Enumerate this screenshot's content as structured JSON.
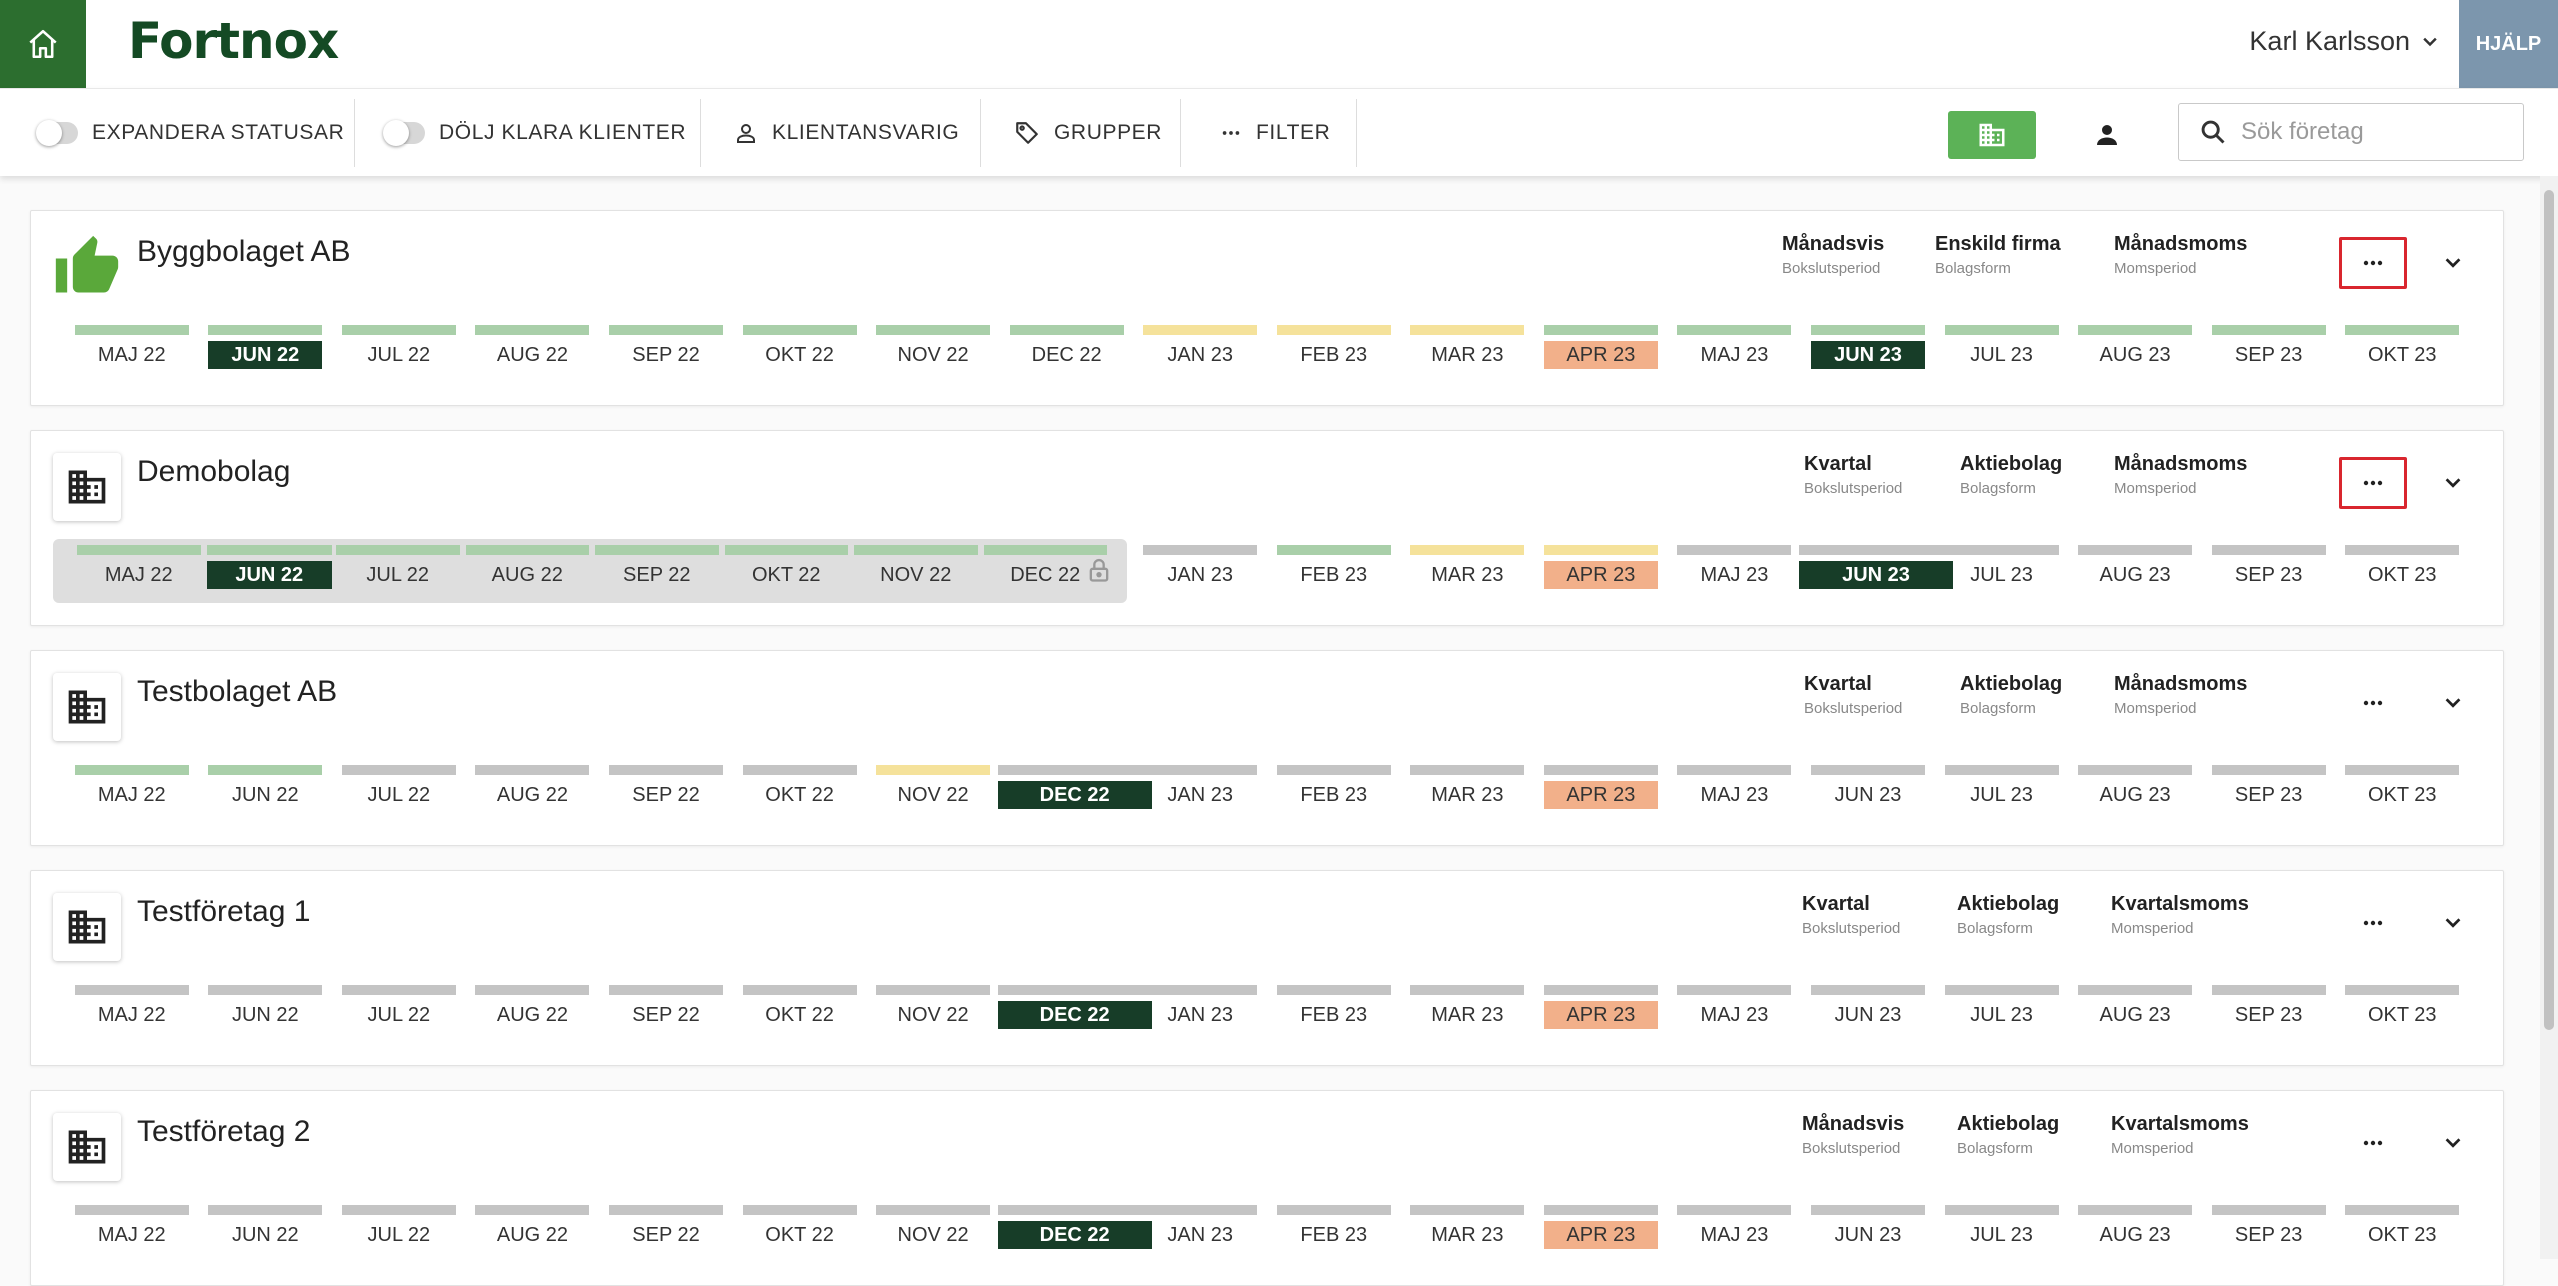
{
  "header": {
    "logo": "Fortnox",
    "user_name": "Karl Karlsson",
    "help_label": "HJÄLP"
  },
  "toolbar": {
    "expand_label": "EXPANDERA STATUSAR",
    "hide_done_label": "DÖLJ KLARA KLIENTER",
    "responsible_label": "KLIENTANSVARIG",
    "groups_label": "GRUPPER",
    "filter_label": "FILTER",
    "search_placeholder": "Sök företag"
  },
  "colors": {
    "brand": "#2c6e2f",
    "done": "#a9cfa9",
    "pending": "#f5e29b",
    "open": "#c4c4c4",
    "current": "#173d28",
    "highlight": "#f2b08a"
  },
  "companies": [
    {
      "name": "Byggbolaget AB",
      "icon": "thumbs-up-icon",
      "closing_period": "Månadsvis",
      "closing_period_label": "Bokslutsperiod",
      "company_form": "Enskild firma",
      "company_form_label": "Bolagsform",
      "vat_period": "Månadsmoms",
      "vat_period_label": "Momsperiod",
      "periods": [
        {
          "label": "MAJ 22",
          "status": "done"
        },
        {
          "label": "JUN 22",
          "status": "done",
          "current": true
        },
        {
          "label": "JUL 22",
          "status": "done"
        },
        {
          "label": "AUG 22",
          "status": "done"
        },
        {
          "label": "SEP 22",
          "status": "done"
        },
        {
          "label": "OKT 22",
          "status": "done"
        },
        {
          "label": "NOV 22",
          "status": "done"
        },
        {
          "label": "DEC 22",
          "status": "done"
        },
        {
          "label": "JAN 23",
          "status": "pending"
        },
        {
          "label": "FEB 23",
          "status": "pending"
        },
        {
          "label": "MAR 23",
          "status": "pending"
        },
        {
          "label": "APR 23",
          "status": "done",
          "highlight": true
        },
        {
          "label": "MAJ 23",
          "status": "done"
        },
        {
          "label": "JUN 23",
          "status": "done",
          "current": true
        },
        {
          "label": "JUL 23",
          "status": "done"
        },
        {
          "label": "AUG 23",
          "status": "done"
        },
        {
          "label": "SEP 23",
          "status": "done"
        },
        {
          "label": "OKT 23",
          "status": "done"
        }
      ]
    },
    {
      "name": "Demobolag",
      "icon": "building-icon",
      "closing_period": "Kvartal",
      "closing_period_label": "Bokslutsperiod",
      "company_form": "Aktiebolag",
      "company_form_label": "Bolagsform",
      "vat_period": "Månadsmoms",
      "vat_period_label": "Momsperiod",
      "periods": [
        {
          "label": "MAJ 22",
          "status": "done"
        },
        {
          "label": "JUN 22",
          "status": "done",
          "current": true
        },
        {
          "label": "JUL 22",
          "status": "done"
        },
        {
          "label": "AUG 22",
          "status": "done"
        },
        {
          "label": "SEP 22",
          "status": "done"
        },
        {
          "label": "OKT 22",
          "status": "done"
        },
        {
          "label": "NOV 22",
          "status": "done"
        },
        {
          "label": "DEC 22",
          "status": "done"
        },
        {
          "label": "JAN 23",
          "status": "open"
        },
        {
          "label": "FEB 23",
          "status": "done"
        },
        {
          "label": "MAR 23",
          "status": "pending"
        },
        {
          "label": "APR 23",
          "status": "pending",
          "highlight": true
        },
        {
          "label": "MAJ 23",
          "status": "open"
        },
        {
          "label": "JUN 23",
          "status": "open",
          "current": true
        },
        {
          "label": "JUL 23",
          "status": "open"
        },
        {
          "label": "AUG 23",
          "status": "open"
        },
        {
          "label": "SEP 23",
          "status": "open"
        },
        {
          "label": "OKT 23",
          "status": "open"
        }
      ]
    },
    {
      "name": "Testbolaget AB",
      "icon": "building-icon",
      "closing_period": "Kvartal",
      "closing_period_label": "Bokslutsperiod",
      "company_form": "Aktiebolag",
      "company_form_label": "Bolagsform",
      "vat_period": "Månadsmoms",
      "vat_period_label": "Momsperiod",
      "periods": [
        {
          "label": "MAJ 22",
          "status": "done"
        },
        {
          "label": "JUN 22",
          "status": "done"
        },
        {
          "label": "JUL 22",
          "status": "open"
        },
        {
          "label": "AUG 22",
          "status": "open"
        },
        {
          "label": "SEP 22",
          "status": "open"
        },
        {
          "label": "OKT 22",
          "status": "open"
        },
        {
          "label": "NOV 22",
          "status": "pending"
        },
        {
          "label": "DEC 22",
          "status": "open",
          "current": true
        },
        {
          "label": "JAN 23",
          "status": "open"
        },
        {
          "label": "FEB 23",
          "status": "open"
        },
        {
          "label": "MAR 23",
          "status": "open"
        },
        {
          "label": "APR 23",
          "status": "open",
          "highlight": true
        },
        {
          "label": "MAJ 23",
          "status": "open"
        },
        {
          "label": "JUN 23",
          "status": "open"
        },
        {
          "label": "JUL 23",
          "status": "open"
        },
        {
          "label": "AUG 23",
          "status": "open"
        },
        {
          "label": "SEP 23",
          "status": "open"
        },
        {
          "label": "OKT 23",
          "status": "open"
        }
      ]
    },
    {
      "name": "Testföretag 1",
      "icon": "building-icon",
      "closing_period": "Kvartal",
      "closing_period_label": "Bokslutsperiod",
      "company_form": "Aktiebolag",
      "company_form_label": "Bolagsform",
      "vat_period": "Kvartalsmoms",
      "vat_period_label": "Momsperiod",
      "periods": [
        {
          "label": "MAJ 22",
          "status": "open"
        },
        {
          "label": "JUN 22",
          "status": "open"
        },
        {
          "label": "JUL 22",
          "status": "open"
        },
        {
          "label": "AUG 22",
          "status": "open"
        },
        {
          "label": "SEP 22",
          "status": "open"
        },
        {
          "label": "OKT 22",
          "status": "open"
        },
        {
          "label": "NOV 22",
          "status": "open"
        },
        {
          "label": "DEC 22",
          "status": "open",
          "current": true
        },
        {
          "label": "JAN 23",
          "status": "open"
        },
        {
          "label": "FEB 23",
          "status": "open"
        },
        {
          "label": "MAR 23",
          "status": "open"
        },
        {
          "label": "APR 23",
          "status": "open",
          "highlight": true
        },
        {
          "label": "MAJ 23",
          "status": "open"
        },
        {
          "label": "JUN 23",
          "status": "open"
        },
        {
          "label": "JUL 23",
          "status": "open"
        },
        {
          "label": "AUG 23",
          "status": "open"
        },
        {
          "label": "SEP 23",
          "status": "open"
        },
        {
          "label": "OKT 23",
          "status": "open"
        }
      ]
    },
    {
      "name": "Testföretag 2",
      "icon": "building-icon",
      "closing_period": "Månadsvis",
      "closing_period_label": "Bokslutsperiod",
      "company_form": "Aktiebolag",
      "company_form_label": "Bolagsform",
      "vat_period": "Kvartalsmoms",
      "vat_period_label": "Momsperiod",
      "periods": [
        {
          "label": "MAJ 22",
          "status": "open"
        },
        {
          "label": "JUN 22",
          "status": "open"
        },
        {
          "label": "JUL 22",
          "status": "open"
        },
        {
          "label": "AUG 22",
          "status": "open"
        },
        {
          "label": "SEP 22",
          "status": "open"
        },
        {
          "label": "OKT 22",
          "status": "open"
        },
        {
          "label": "NOV 22",
          "status": "open"
        },
        {
          "label": "DEC 22",
          "status": "open",
          "current": true
        },
        {
          "label": "JAN 23",
          "status": "open"
        },
        {
          "label": "FEB 23",
          "status": "open"
        },
        {
          "label": "MAR 23",
          "status": "open"
        },
        {
          "label": "APR 23",
          "status": "open",
          "highlight": true
        },
        {
          "label": "MAJ 23",
          "status": "open"
        },
        {
          "label": "JUN 23",
          "status": "open"
        },
        {
          "label": "JUL 23",
          "status": "open"
        },
        {
          "label": "AUG 23",
          "status": "open"
        },
        {
          "label": "SEP 23",
          "status": "open"
        },
        {
          "label": "OKT 23",
          "status": "open"
        }
      ]
    }
  ]
}
